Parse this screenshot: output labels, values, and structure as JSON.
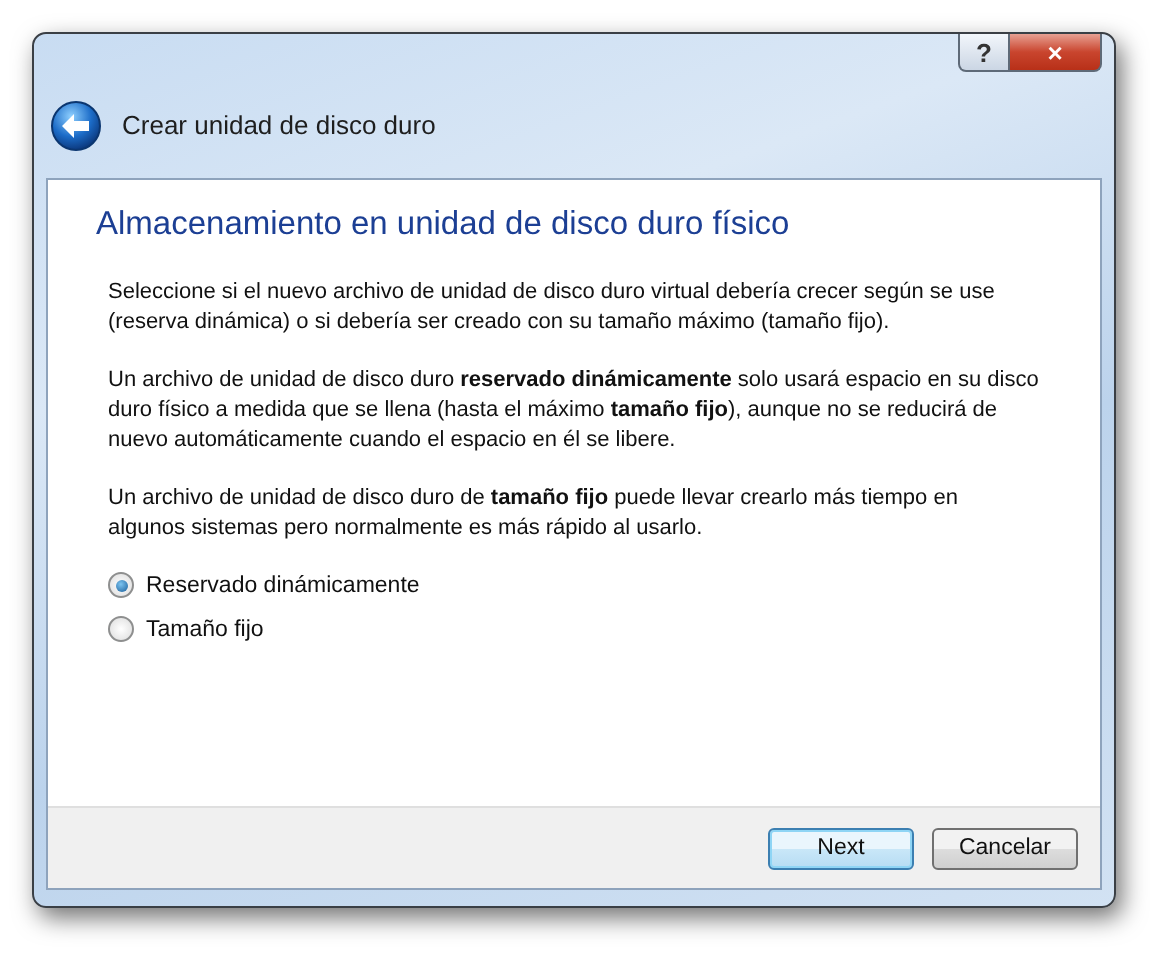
{
  "window": {
    "title": "Crear unidad de disco duro",
    "help_button": "?",
    "close_button": "×"
  },
  "page": {
    "heading": "Almacenamiento en unidad de disco duro físico",
    "paragraphs": [
      "Seleccione si el nuevo archivo de unidad de disco duro virtual debería crecer según se use (reserva dinámica) o si debería ser creado con su tamaño máximo (tamaño fijo).",
      "Un archivo de unidad de disco duro **reservado dinámicamente** solo usará espacio en su disco duro físico a medida que se llena (hasta el máximo **tamaño fijo**), aunque no se reducirá de nuevo automáticamente cuando el espacio en él se libere.",
      "Un archivo de unidad de disco duro de **tamaño fijo** puede llevar crearlo más tiempo en algunos sistemas pero normalmente es más rápido al usarlo."
    ],
    "options": [
      {
        "label": "Reservado dinámicamente",
        "selected": true
      },
      {
        "label": "Tamaño fijo",
        "selected": false
      }
    ]
  },
  "buttons": [
    {
      "label": "Next",
      "default": true
    },
    {
      "label": "Cancelar",
      "default": false
    }
  ]
}
